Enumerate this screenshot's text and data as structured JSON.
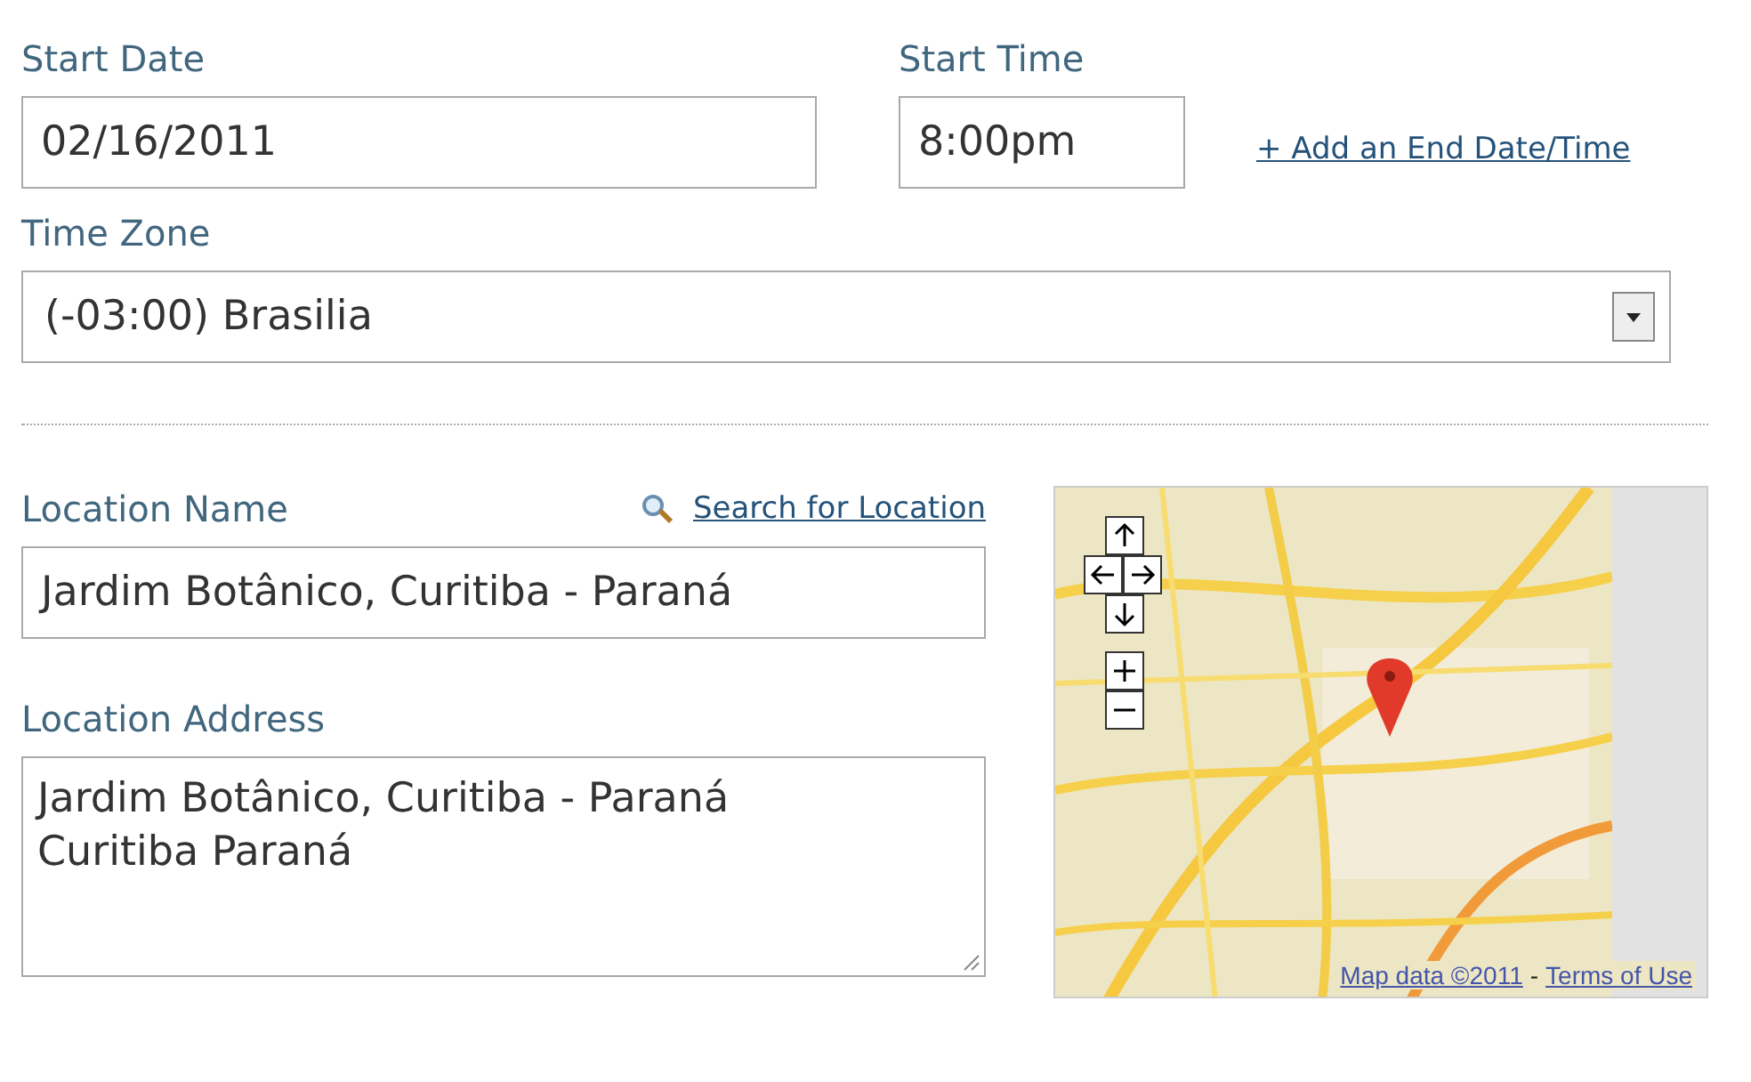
{
  "start_date": {
    "label": "Start Date",
    "value": "02/16/2011"
  },
  "start_time": {
    "label": "Start Time",
    "value": "8:00pm"
  },
  "end_link": "+ Add an End Date/Time",
  "time_zone": {
    "label": "Time Zone",
    "value": "(-03:00) Brasilia"
  },
  "location_name": {
    "label": "Location Name",
    "search_link": "Search for Location",
    "value": "Jardim Botânico, Curitiba - Paraná"
  },
  "location_address": {
    "label": "Location Address",
    "value": "Jardim Botânico, Curitiba - Paraná\nCuritiba Paraná"
  },
  "map": {
    "map_data": "Map data ©2011",
    "separator": "-",
    "terms_link": "Terms of Use"
  }
}
